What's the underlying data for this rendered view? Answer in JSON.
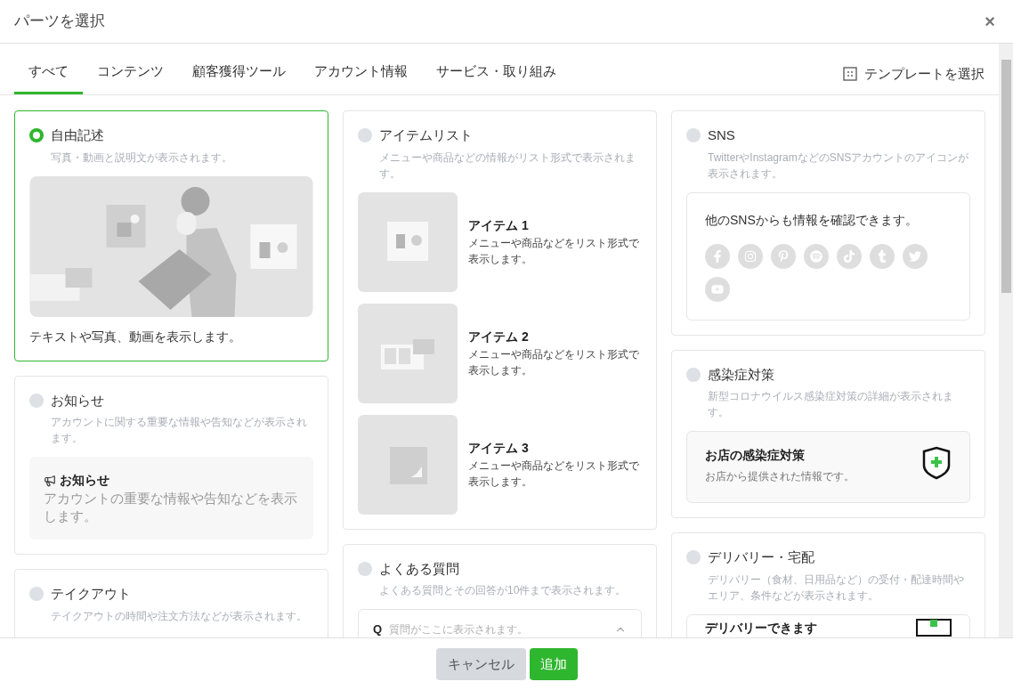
{
  "dialog": {
    "title": "パーツを選択",
    "close": "×"
  },
  "tabs": [
    {
      "label": "すべて",
      "selected": true
    },
    {
      "label": "コンテンツ",
      "selected": false
    },
    {
      "label": "顧客獲得ツール",
      "selected": false
    },
    {
      "label": "アカウント情報",
      "selected": false
    },
    {
      "label": "サービス・取り組み",
      "selected": false
    }
  ],
  "template_link": "テンプレートを選択",
  "columns": [
    [
      {
        "kind": "free_text",
        "title": "自由記述",
        "selected": true,
        "description": "写真・動画と説明文が表示されます。",
        "caption": "テキストや写真、動画を表示します。"
      },
      {
        "kind": "notice",
        "title": "お知らせ",
        "selected": false,
        "description": "アカウントに関する重要な情報や告知などが表示されます。",
        "preview_title": "お知らせ",
        "preview_body": "アカウントの重要な情報や告知などを表示します。"
      },
      {
        "kind": "plain",
        "title": "テイクアウト",
        "selected": false,
        "description": "テイクアウトの時間や注文方法などが表示されます。"
      }
    ],
    [
      {
        "kind": "item_list",
        "title": "アイテムリスト",
        "selected": false,
        "description": "メニューや商品などの情報がリスト形式で表示されます。",
        "items": [
          {
            "name": "アイテム 1",
            "text": "メニューや商品などをリスト形式で表示します。"
          },
          {
            "name": "アイテム 2",
            "text": "メニューや商品などをリスト形式で表示します。"
          },
          {
            "name": "アイテム 3",
            "text": "メニューや商品などをリスト形式で表示します。"
          }
        ]
      },
      {
        "kind": "faq",
        "title": "よくある質問",
        "selected": false,
        "description": "よくある質問とその回答が10件まで表示されます。",
        "q_mark": "Q",
        "question": "質問がここに表示されます。"
      }
    ],
    [
      {
        "kind": "sns",
        "title": "SNS",
        "selected": false,
        "description": "TwitterやInstagramなどのSNSアカウントのアイコンが表示されます。",
        "preview_text": "他のSNSからも情報を確認できます。"
      },
      {
        "kind": "infection",
        "title": "感染症対策",
        "selected": false,
        "description": "新型コロナウイルス感染症対策の詳細が表示されます。",
        "preview_title": "お店の感染症対策",
        "preview_body": "お店から提供された情報です。"
      },
      {
        "kind": "delivery",
        "title": "デリバリー・宅配",
        "selected": false,
        "description": "デリバリー（食材、日用品など）の受付・配達時間やエリア、条件などが表示されます。",
        "preview_title": "デリバリーできます"
      }
    ]
  ],
  "buttons": [
    {
      "label": "キャンセル",
      "kind": "secondary"
    },
    {
      "label": "追加",
      "kind": "primary"
    }
  ]
}
